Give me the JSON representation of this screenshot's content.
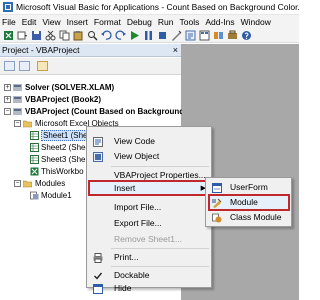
{
  "window": {
    "title": "Microsoft Visual Basic for Applications - Count Based on Background Color.xlsm"
  },
  "menubar": {
    "items": [
      "File",
      "Edit",
      "View",
      "Insert",
      "Format",
      "Debug",
      "Run",
      "Tools",
      "Add-Ins",
      "Window"
    ]
  },
  "project_panel": {
    "title": "Project - VBAProject",
    "close_glyph": "×",
    "tree": {
      "solver": "Solver (SOLVER.XLAM)",
      "book2": "VBAProject (Book2)",
      "count": "VBAProject (Count Based on Background",
      "excel_objects": "Microsoft Excel Objects",
      "sheet1": "Sheet1 (Sheet1)",
      "sheet2": "Sheet2 (Shee",
      "sheet3": "Sheet3 (She",
      "thisworkbook": "ThisWorkbo",
      "modules": "Modules",
      "module1": "Module1"
    }
  },
  "context_menu": {
    "view_code": "View Code",
    "view_object": "View Object",
    "vbaproject_properties": "VBAProject Properties...",
    "insert": "Insert",
    "import_file": "Import File...",
    "export_file": "Export File...",
    "remove": "Remove Sheet1...",
    "print": "Print...",
    "dockable": "Dockable",
    "hide": "Hide"
  },
  "submenu": {
    "userform": "UserForm",
    "module": "Module",
    "class_module": "Class Module"
  },
  "colors": {
    "highlight_border": "#c0282d",
    "panel_title_bg": "#dde6f3",
    "client_area_bg": "#a8a8a8"
  }
}
